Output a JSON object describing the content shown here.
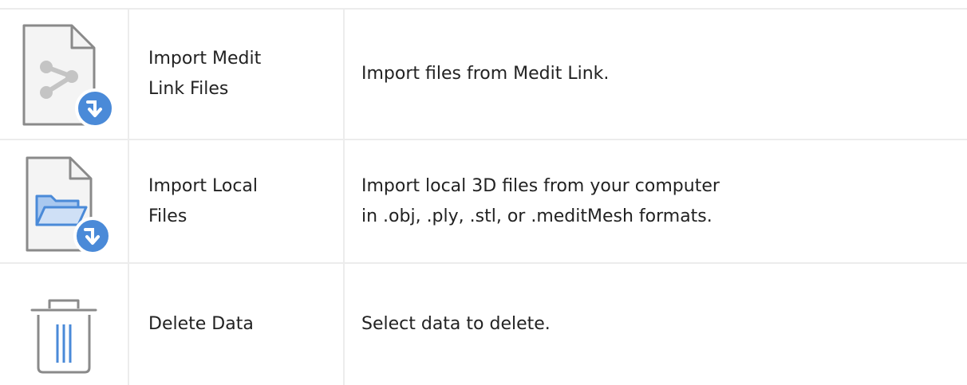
{
  "rows": [
    {
      "icon": "medit-link-import-icon",
      "name": "Import Medit\nLink Files",
      "description_lines": [
        "Import files from Medit Link."
      ]
    },
    {
      "icon": "local-folder-import-icon",
      "name": "Import Local\nFiles",
      "description_lines": [
        "Import local 3D files from your computer",
        "in .obj, .ply, .stl, or .meditMesh formats."
      ]
    },
    {
      "icon": "trash-icon",
      "name": "Delete Data",
      "description_lines": [
        "Select data to delete."
      ]
    }
  ],
  "colors": {
    "accent_blue": "#4a8ad8",
    "icon_gray": "#8a8a8a",
    "grid_line": "#ececec"
  }
}
